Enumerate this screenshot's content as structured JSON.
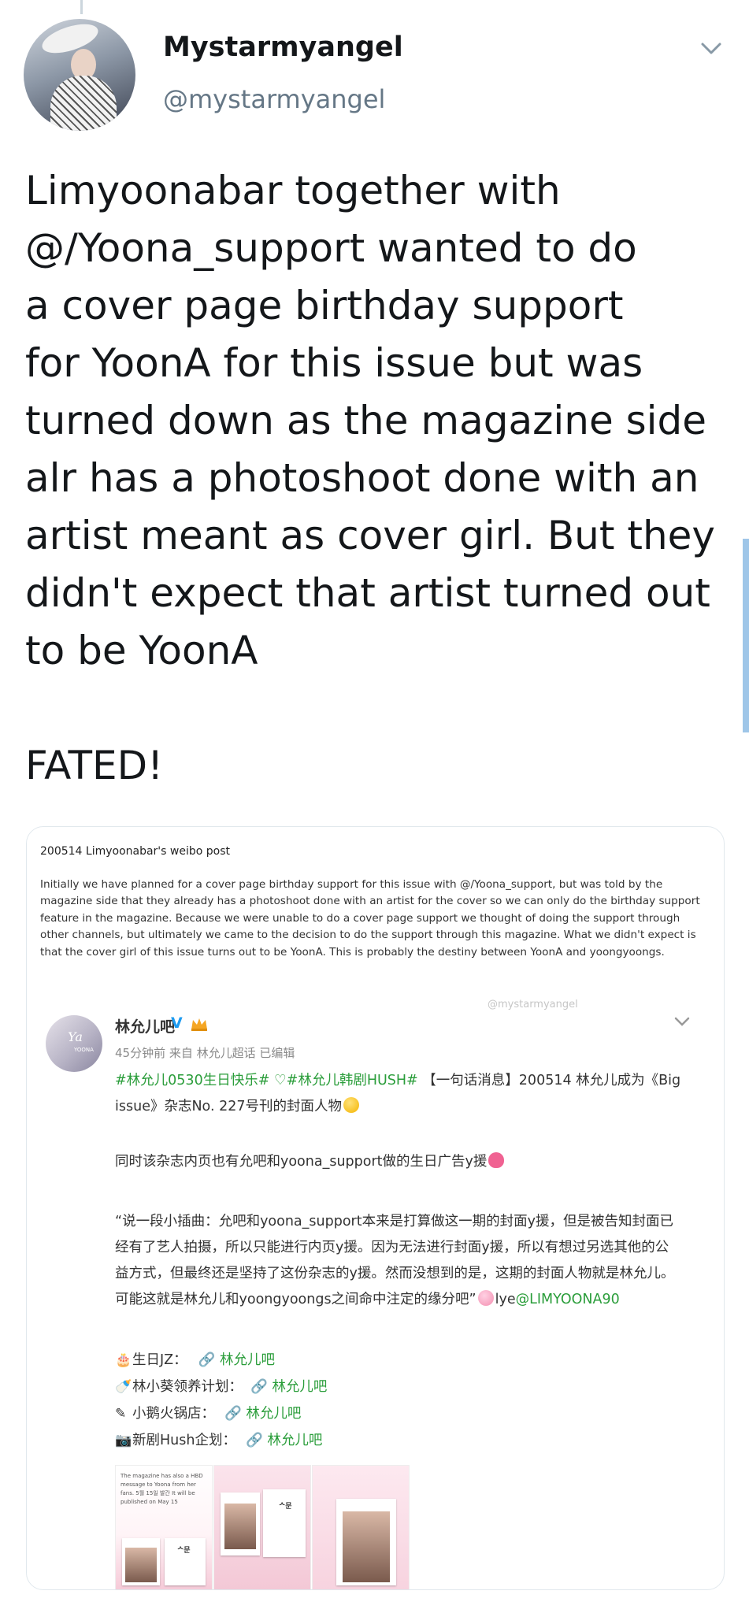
{
  "tweet": {
    "author": {
      "display_name": "Mystarmyangel",
      "handle": "@mystarmyangel",
      "avatar_icon": "profile-photo"
    },
    "text": "Limyoonabar together with\n@/Yoona_support wanted to do\na cover page birthday support\nfor YoonA for this issue but was\nturned down as the magazine side\nalr has a photoshoot done with an\nartist meant as cover girl. But they\ndidn't expect that artist turned out\nto be YoonA\n\nFATED!",
    "menu_icon": "chevron-down-icon"
  },
  "media": {
    "caption_title": "200514 Limyoonabar's weibo post",
    "caption_body": "Initially we have planned for a cover page birthday support for this issue with @/Yoona_support, but was told by the magazine side that they already has a photoshoot done with an artist for the cover so we can only do the birthday support feature in the magazine. Because we were unable to do a cover page support we thought of doing the support through other channels, but ultimately we came to the decision to do the support through this magazine. What we didn't expect is that the cover girl of this issue turns out to be YoonA. This is probably the destiny between YoonA and yoongyoongs.",
    "watermark": "@mystarmyangel",
    "weibo": {
      "name": "林允儿吧",
      "verified_mark": "V",
      "meta": "45分钟前  来自 林允儿超话  已编辑",
      "p1_hashtag1": "#林允儿0530生日快乐#",
      "p1_heart": "♡",
      "p1_hashtag2": "#林允儿韩剧HUSH#",
      "p1_rest": "【一句话消息】200514 林允儿成为《Big issue》杂志No. 227号刊的封面人物",
      "p2": "同时该杂志内页也有允吧和yoona_support做的生日广告y援",
      "p3": "“说一段小插曲：允吧和yoona_support本来是打算做这一期的封面y援，但是被告知封面已经有了艺人拍摄，所以只能进行内页y援。因为无法进行封面y援，所以有想过另选其他的公益方式，但最终还是坚持了这份杂志的y援。然而没想到的是，这期的封面人物就是林允儿。可能这就是林允儿和yoongyoongs之间命中注定的缘分吧”",
      "p3_suffix": "lye",
      "p3_mention": "@LIMYOONA90",
      "links": [
        {
          "icon": "🎂",
          "label": "生日JZ：",
          "link": "🔗 林允儿吧"
        },
        {
          "icon": "🍼",
          "label": "林小葵领养计划：",
          "link": "🔗 林允儿吧"
        },
        {
          "icon": "✎",
          "label": "小鹅火锅店：",
          "link": "🔗 林允儿吧"
        },
        {
          "icon": "📷",
          "label": "新剧Hush企划：",
          "link": "🔗 林允儿吧"
        }
      ],
      "thumb1_text": "The magazine has also a HBD message to Yoona from her fans. 5월 15일 발간 It will be published on May 15"
    }
  }
}
